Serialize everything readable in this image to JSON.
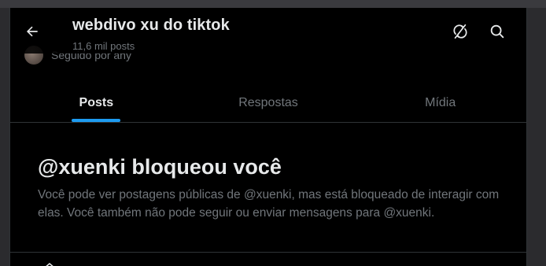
{
  "header": {
    "title": "webdivo xu do tiktok",
    "posts_count": "11,6 mil posts",
    "back_icon": "arrow-left-icon",
    "sync_icon": "sync-off-icon",
    "search_icon": "search-icon"
  },
  "behind": {
    "followed_text": "Seguido por any"
  },
  "tabs": [
    {
      "label": "Posts",
      "active": true
    },
    {
      "label": "Respostas",
      "active": false
    },
    {
      "label": "Mídia",
      "active": false
    }
  ],
  "blocked": {
    "heading": "@xuenki bloqueou você",
    "message": "Você pode ver postagens públicas de @xuenki, mas está bloqueado de interagir com elas. Você também não pode seguir ou enviar mensagens para @xuenki."
  },
  "colors": {
    "accent": "#1d9bf0",
    "background": "#000000",
    "secondary_text": "#71767b"
  }
}
